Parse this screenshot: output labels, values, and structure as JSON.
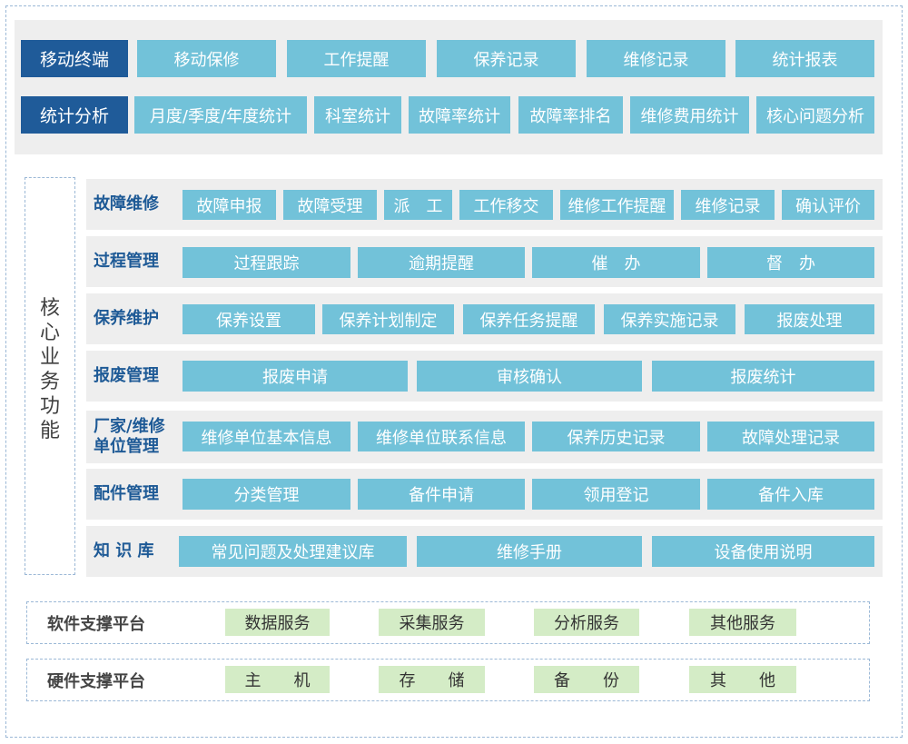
{
  "top": {
    "mobile": {
      "label": "移动终端",
      "items": [
        "移动保修",
        "工作提醒",
        "保养记录",
        "维修记录",
        "统计报表"
      ]
    },
    "stats": {
      "label": "统计分析",
      "items": [
        "月度/季度/年度统计",
        "科室统计",
        "故障率统计",
        "故障率排名",
        "维修费用统计",
        "核心问题分析"
      ]
    }
  },
  "core": {
    "side_label": "核心业务功能",
    "rows": [
      {
        "label": "故障维修",
        "items": [
          "故障申报",
          "故障受理",
          "派　工",
          "工作移交",
          "维修工作提醒",
          "维修记录",
          "确认评价"
        ]
      },
      {
        "label": "过程管理",
        "items": [
          "过程跟踪",
          "逾期提醒",
          "催　办",
          "督　办"
        ]
      },
      {
        "label": "保养维护",
        "items": [
          "保养设置",
          "保养计划制定",
          "保养任务提醒",
          "保养实施记录",
          "报废处理"
        ]
      },
      {
        "label": "报废管理",
        "items": [
          "报废申请",
          "审核确认",
          "报废统计"
        ]
      },
      {
        "label": "厂家/维修\n单位管理",
        "items": [
          "维修单位基本信息",
          "维修单位联系信息",
          "保养历史记录",
          "故障处理记录"
        ]
      },
      {
        "label": "配件管理",
        "items": [
          "分类管理",
          "备件申请",
          "领用登记",
          "备件入库"
        ]
      },
      {
        "label": "知 识 库",
        "items": [
          "常见问题及处理建议库",
          "维修手册",
          "设备使用说明"
        ]
      }
    ]
  },
  "software": {
    "label": "软件支撑平台",
    "items": [
      "数据服务",
      "采集服务",
      "分析服务",
      "其他服务"
    ]
  },
  "hardware": {
    "label": "硬件支撑平台",
    "items": [
      "主　　机",
      "存　　储",
      "备　　份",
      "其　　他"
    ]
  }
}
